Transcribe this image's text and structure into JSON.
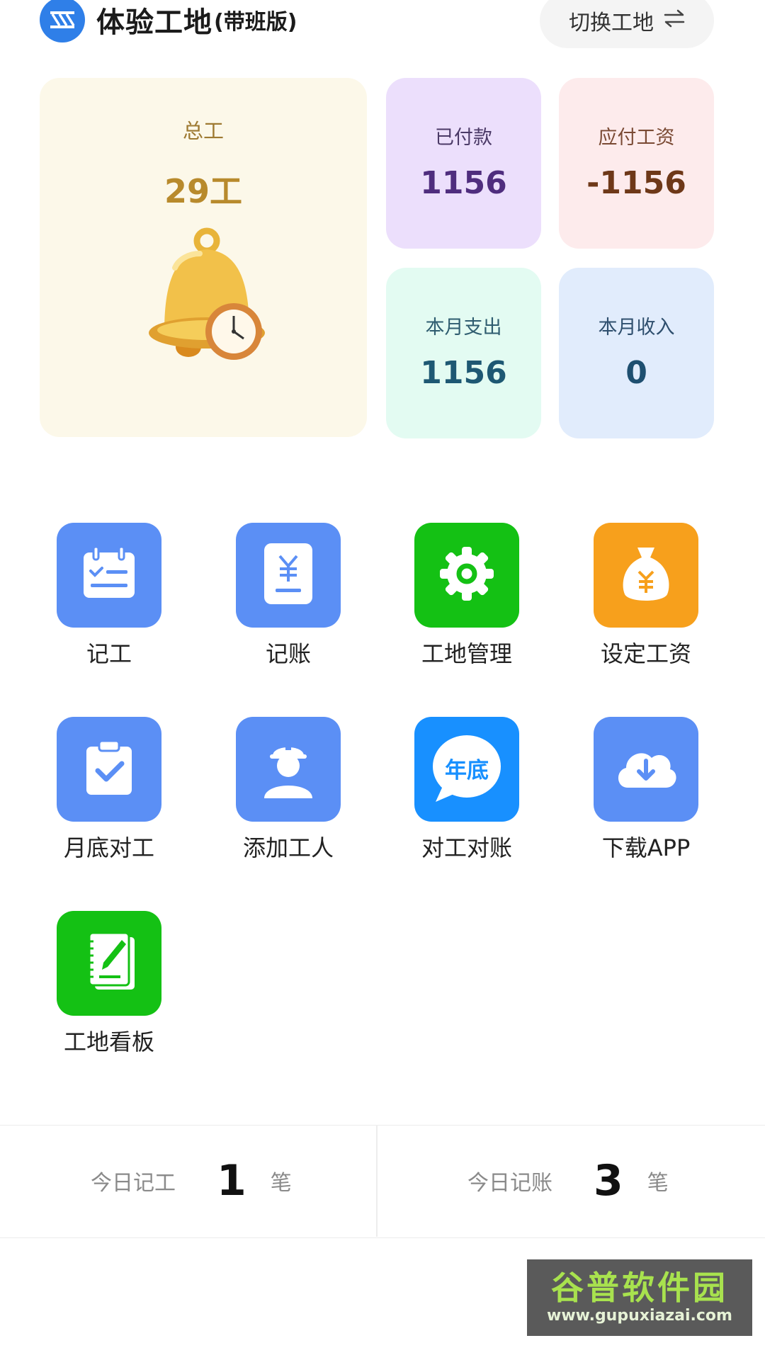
{
  "header": {
    "site_name": "体验工地",
    "edition": "(带班版)",
    "switch_label": "切换工地",
    "switch_icon": "swap-arrows-icon",
    "logo_icon": "site-logo-icon"
  },
  "summary": {
    "total": {
      "label": "总工",
      "value": "29工",
      "icon": "bell-clock-icon"
    },
    "paid": {
      "label": "已付款",
      "value": "1156"
    },
    "wage_due": {
      "label": "应付工资",
      "value": "-1156"
    },
    "month_expense": {
      "label": "本月支出",
      "value": "1156"
    },
    "month_income": {
      "label": "本月收入",
      "value": "0"
    }
  },
  "menu": {
    "items": [
      {
        "label": "记工",
        "icon": "calendar-check-icon",
        "color": "#5b8ff5"
      },
      {
        "label": "记账",
        "icon": "yuan-receipt-icon",
        "color": "#5b8ff5"
      },
      {
        "label": "工地管理",
        "icon": "gear-icon",
        "color": "#14c114"
      },
      {
        "label": "设定工资",
        "icon": "money-bag-icon",
        "color": "#f7a01c"
      },
      {
        "label": "月底对工",
        "icon": "clipboard-check-icon",
        "color": "#5b8ff5"
      },
      {
        "label": "添加工人",
        "icon": "worker-helmet-icon",
        "color": "#5b8ff5"
      },
      {
        "label": "对工对账",
        "icon": "chat-bubble-icon",
        "badge_text": "年底",
        "color": "#1890ff"
      },
      {
        "label": "下载APP",
        "icon": "cloud-download-icon",
        "color": "#5b8ff5"
      },
      {
        "label": "工地看板",
        "icon": "notebook-pen-icon",
        "color": "#14c114"
      }
    ]
  },
  "today": {
    "work": {
      "label": "今日记工",
      "count": "1",
      "unit": "笔"
    },
    "account": {
      "label": "今日记账",
      "count": "3",
      "unit": "笔"
    }
  },
  "watermark": {
    "title": "谷普软件园",
    "url": "www.gupuxiazai.com"
  }
}
